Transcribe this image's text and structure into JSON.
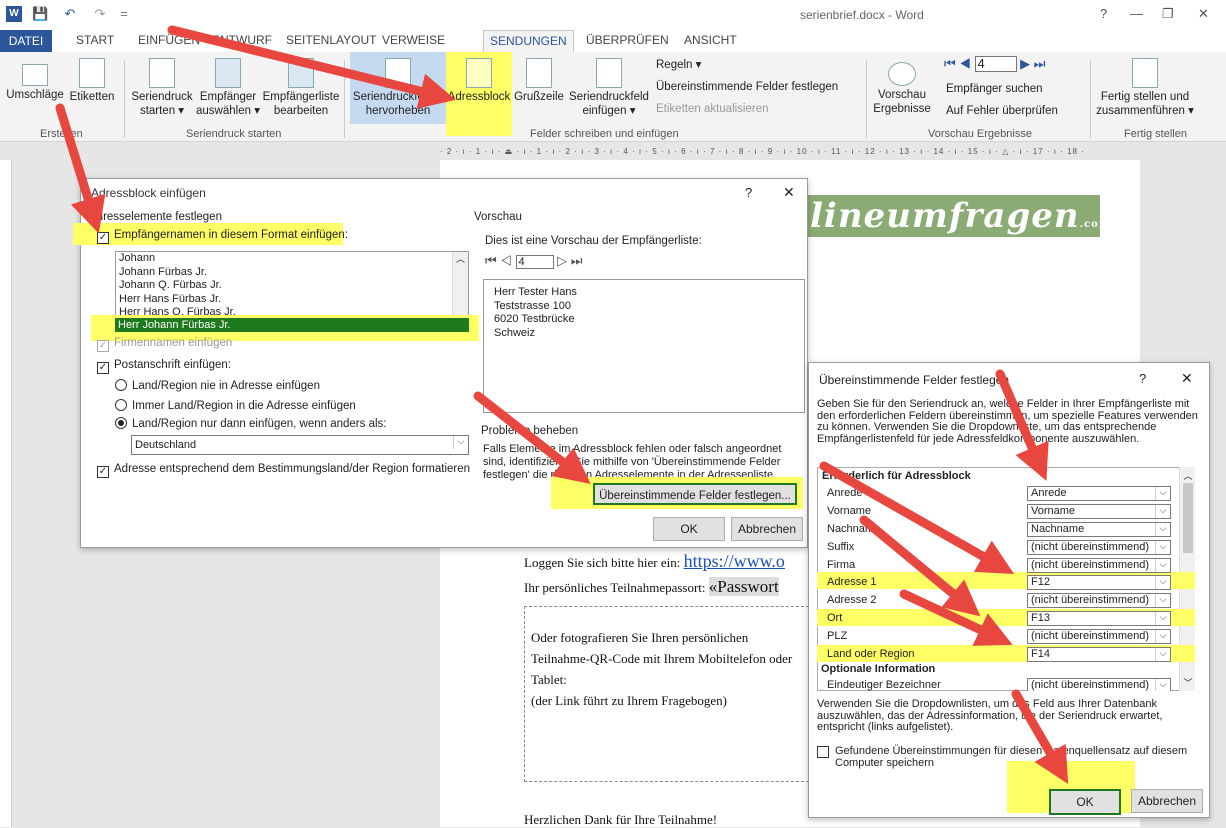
{
  "titlebar": {
    "title": "serienbrief.docx - Word",
    "quick_access": [
      "W",
      "💾",
      "↶",
      "↷",
      "="
    ],
    "window_buttons": [
      "?",
      "—",
      "❐",
      "✕"
    ]
  },
  "tabs": [
    "DATEI",
    "START",
    "EINFÜGEN",
    "ENTWURF",
    "SEITENLAYOUT",
    "VERWEISE",
    "SENDUNGEN",
    "ÜBERPRÜFEN",
    "ANSICHT"
  ],
  "ribbon": {
    "umschlaege": "Umschläge",
    "etiketten": "Etiketten",
    "group_erstellen": "Erstellen",
    "seriendruck_starten": "Seriendruck starten ▾",
    "empfaenger_auswaehlen": "Empfänger auswählen ▾",
    "empfaengerliste_bearbeiten": "Empfängerliste bearbeiten",
    "group_seriendruck": "Seriendruck starten",
    "seriendruckfelder": "Seriendruckfelder hervorheben",
    "adressblock": "Adressblock",
    "grusszeile": "Grußzeile",
    "seriendruckfeld": "Seriendruckfeld einfügen ▾",
    "regeln": "Regeln ▾",
    "uebereinstimmende": "Übereinstimmende Felder festlegen",
    "etiketten_aktualisieren": "Etiketten aktualisieren",
    "group_felder": "Felder schreiben und einfügen",
    "vorschau": "Vorschau Ergebnisse",
    "record": "4",
    "empfaenger_suchen": "Empfänger suchen",
    "auf_fehler": "Auf Fehler überprüfen",
    "group_vorschau": "Vorschau Ergebnisse",
    "fertig_stellen": "Fertig stellen und zusammenführen ▾",
    "group_fertig": "Fertig stellen"
  },
  "ruler": "· 2 · ı · 1 · ı · ⏏ · ı · 1 · ı · 2 · ı · 3 · ı · 4 · ı · 5 · ı · 6 · ı · 7 · ı · 8 · ı · 9 · ı · 10 · ı · 11 · ı · 12 · ı · 13 · ı · 14 · ı · 15 · ı · △ · ı · 17 · ı · 18 ·",
  "document": {
    "logo": "lineumfragen",
    "logo_sub": ".com",
    "login": "Loggen Sie sich bitte hier ein:",
    "login_link": "https://www.o",
    "passport": "Ihr persönliches Teilnahmepassort:",
    "passport_field": "«Passwort",
    "qr_text": [
      "Oder fotografieren Sie Ihren persönlichen",
      "Teilnahme-QR-Code mit Ihrem Mobiltelefon oder",
      "Tablet:",
      "(der Link führt zu Ihrem Fragebogen)"
    ],
    "thanks": "Herzlichen Dank für Ihre Teilnahme!"
  },
  "dialog1": {
    "title": "Adressblock einfügen",
    "help": "?",
    "close": "✕",
    "section_left": "Adresselemente festlegen",
    "names_checkbox": "Empfängernamen in diesem Format einfügen:",
    "name_formats": [
      "Johann",
      "Johann Fürbas Jr.",
      "Johann Q. Fürbas Jr.",
      "Herr Hans Fürbas Jr.",
      "Herr Hans Q. Fürbas Jr.",
      "Herr Johann Fürbas Jr."
    ],
    "firmenname": "Firmennamen einfügen",
    "postanschrift": "Postanschrift einfügen:",
    "radio_never": "Land/Region nie in Adresse einfügen",
    "radio_always": "Immer Land/Region in die Adresse einfügen",
    "radio_only": "Land/Region nur dann einfügen, wenn anders als:",
    "country": "Deutschland",
    "format_checkbox": "Adresse entsprechend dem Bestimmungsland/der Region formatieren",
    "section_preview": "Vorschau",
    "preview_desc": "Dies ist eine Vorschau der Empfängerliste:",
    "preview_record": "4",
    "preview_address": [
      "Herr Tester Hans",
      "Teststrasse 100",
      "6020 Testbrücke",
      "Schweiz"
    ],
    "section_problems": "Probleme beheben",
    "problems_text": "Falls Elemente im Adressblock fehlen oder falsch angeordnet sind, identifizieren Sie mithilfe von 'Übereinstimmende Felder festlegen' die richtigen Adresselemente in der Adressenliste.",
    "match_button": "Übereinstimmende Felder festlegen...",
    "ok": "OK",
    "cancel": "Abbrechen"
  },
  "dialog2": {
    "title": "Übereinstimmende Felder festlegen",
    "help": "?",
    "close": "✕",
    "intro": "Geben Sie für den Seriendruck an, welche Felder in Ihrer Empfängerliste mit den erforderlichen Feldern übereinstimmen, um spezielle Features verwenden zu können. Verwenden Sie die Dropdownliste, um das entsprechende Empfängerlistenfeld für jede Adressfeldkomponente auszuwählen.",
    "required_header": "Erforderlich für Adressblock",
    "fields": [
      {
        "name": "Anrede",
        "value": "Anrede"
      },
      {
        "name": "Vorname",
        "value": "Vorname"
      },
      {
        "name": "Nachname",
        "value": "Nachname"
      },
      {
        "name": "Suffix",
        "value": "(nicht übereinstimmend)"
      },
      {
        "name": "Firma",
        "value": "(nicht übereinstimmend)"
      },
      {
        "name": "Adresse 1",
        "value": "F12"
      },
      {
        "name": "Adresse 2",
        "value": "(nicht übereinstimmend)"
      },
      {
        "name": "Ort",
        "value": "F13"
      },
      {
        "name": "PLZ",
        "value": "(nicht übereinstimmend)"
      },
      {
        "name": "Land oder Region",
        "value": "F14"
      }
    ],
    "optional_header": "Optionale Information",
    "optional_field": {
      "name": "Eindeutiger Bezeichner",
      "value": "(nicht übereinstimmend)"
    },
    "footer_text": "Verwenden Sie die Dropdownlisten, um das Feld aus Ihrer Datenbank auszuwählen, das der Adressinformation, die der Seriendruck erwartet, entspricht (links aufgelistet).",
    "save_checkbox": "Gefundene Übereinstimmungen für diesen Datenquellensatz auf diesem Computer speichern",
    "ok": "OK",
    "cancel": "Abbrechen"
  },
  "colors": {
    "accent": "#2b579a",
    "highlight": "#ffff66",
    "arrow": "#e8473f",
    "selected": "#1e7a1e",
    "logo_green": "#8aab73"
  }
}
